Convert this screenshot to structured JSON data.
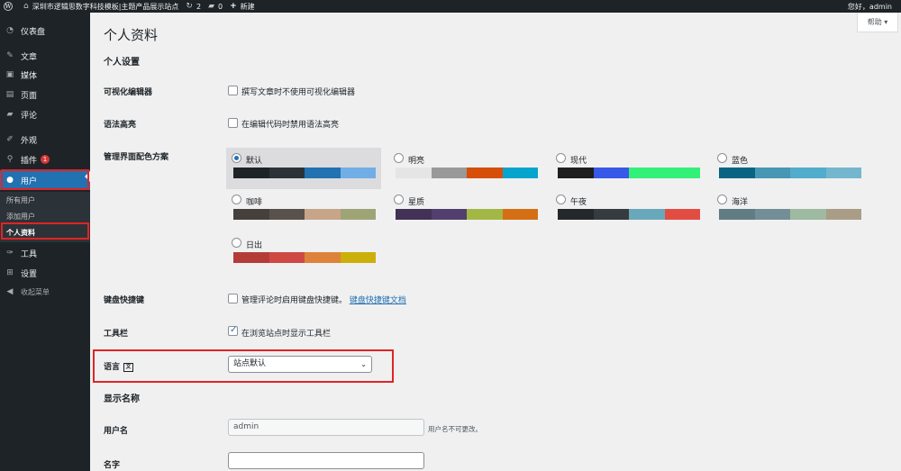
{
  "adminbar": {
    "site_name": "深圳市逻辑思数字科技模板|主题产品展示站点",
    "updates_count": "2",
    "comments_count": "0",
    "new_label": "新建",
    "greeting": "您好，admin"
  },
  "sidebar": {
    "items": [
      {
        "label": "仪表盘",
        "icon": "dashboard-icon"
      },
      {
        "label": "文章",
        "icon": "pin-icon"
      },
      {
        "label": "媒体",
        "icon": "media-icon"
      },
      {
        "label": "页面",
        "icon": "page-icon"
      },
      {
        "label": "评论",
        "icon": "comment-icon"
      },
      {
        "label": "外观",
        "icon": "brush-icon"
      },
      {
        "label": "插件",
        "icon": "plugin-icon",
        "badge": "1"
      },
      {
        "label": "用户",
        "icon": "user-icon"
      },
      {
        "label": "工具",
        "icon": "wrench-icon"
      },
      {
        "label": "设置",
        "icon": "settings-icon"
      },
      {
        "label": "收起菜单",
        "icon": "collapse-icon"
      }
    ],
    "submenu": [
      "所有用户",
      "添加用户",
      "个人资料"
    ]
  },
  "help_label": "帮助",
  "page_title": "个人资料",
  "personal": {
    "title": "个人设置",
    "visual_editor_label": "可视化编辑器",
    "visual_editor_option": "撰写文章时不使用可视化编辑器",
    "syntax_label": "语法高亮",
    "syntax_option": "在编辑代码时禁用语法高亮",
    "color_scheme_label": "管理界面配色方案",
    "schemes": [
      {
        "name": "默认",
        "colors": [
          "#1d2327",
          "#2c3338",
          "#2271b1",
          "#72aee6"
        ]
      },
      {
        "name": "明亮",
        "colors": [
          "#e5e5e5",
          "#999999",
          "#d64e07",
          "#04a4cc"
        ]
      },
      {
        "name": "现代",
        "colors": [
          "#1e1e1e",
          "#3858e9",
          "#33f078",
          "#33f078"
        ]
      },
      {
        "name": "蓝色",
        "colors": [
          "#096484",
          "#4796b3",
          "#52accc",
          "#74b6ce"
        ]
      },
      {
        "name": "咖啡",
        "colors": [
          "#46403c",
          "#59524c",
          "#c7a589",
          "#9ea476"
        ]
      },
      {
        "name": "星质",
        "colors": [
          "#413256",
          "#523f6d",
          "#a3b745",
          "#d46f15"
        ]
      },
      {
        "name": "午夜",
        "colors": [
          "#25282b",
          "#363b3f",
          "#69a8bb",
          "#e14d43"
        ]
      },
      {
        "name": "海洋",
        "colors": [
          "#627c83",
          "#738e96",
          "#9ebaa0",
          "#aa9d88"
        ]
      },
      {
        "name": "日出",
        "colors": [
          "#b43c38",
          "#cf4944",
          "#dd823b",
          "#ccaf0b"
        ]
      }
    ],
    "selected_scheme": "默认",
    "shortcuts_label": "键盘快捷键",
    "shortcuts_option": "管理评论时启用键盘快捷键。",
    "shortcuts_link": "键盘快捷键文档",
    "toolbar_label": "工具栏",
    "toolbar_option": "在浏览站点时显示工具栏",
    "toolbar_checked": true,
    "language_label": "语言",
    "language_value": "站点默认"
  },
  "name_section": {
    "title": "显示名称",
    "username_label": "用户名",
    "username_value": "admin",
    "username_desc": "用户名不可更改。",
    "firstname_label": "名字",
    "firstname_value": ""
  }
}
